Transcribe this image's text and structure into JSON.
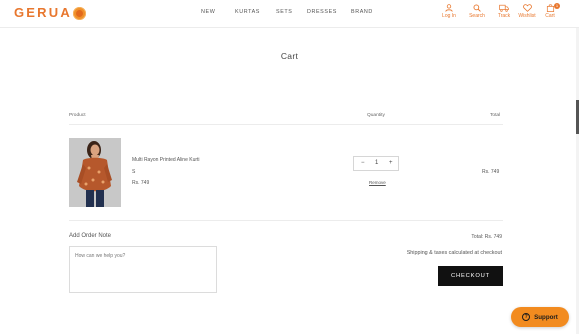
{
  "brand": {
    "logo_text": "GERUA",
    "accent": "#e8772e"
  },
  "nav": [
    "NEW",
    "KURTAS",
    "SETS",
    "DRESSES",
    "BRAND"
  ],
  "header_icons": [
    {
      "label": "Log In",
      "icon": "user-icon"
    },
    {
      "label": "Search",
      "icon": "search-icon"
    },
    {
      "label": "Track",
      "icon": "truck-icon"
    },
    {
      "label": "Wishlist",
      "icon": "heart-icon"
    },
    {
      "label": "Cart",
      "icon": "bag-icon",
      "badge": "1"
    }
  ],
  "page": {
    "title": "Cart"
  },
  "table": {
    "headers": {
      "product": "Product",
      "quantity": "Quantity",
      "total": "Total"
    }
  },
  "item": {
    "name": "Multi Rayon Printed Aline Kurti",
    "size": "S",
    "price": "Rs. 749",
    "qty_minus": "−",
    "quantity": "1",
    "qty_plus": "+",
    "remove": "Remove",
    "line_total": "Rs. 749"
  },
  "order_note": {
    "label": "Add Order Note",
    "placeholder": "How can we help you?"
  },
  "summary": {
    "total": "Total: Rs. 749",
    "shipping_note": "Shipping & taxes calculated at checkout",
    "checkout_label": "CHECKOUT"
  },
  "support": {
    "label": "Support"
  }
}
